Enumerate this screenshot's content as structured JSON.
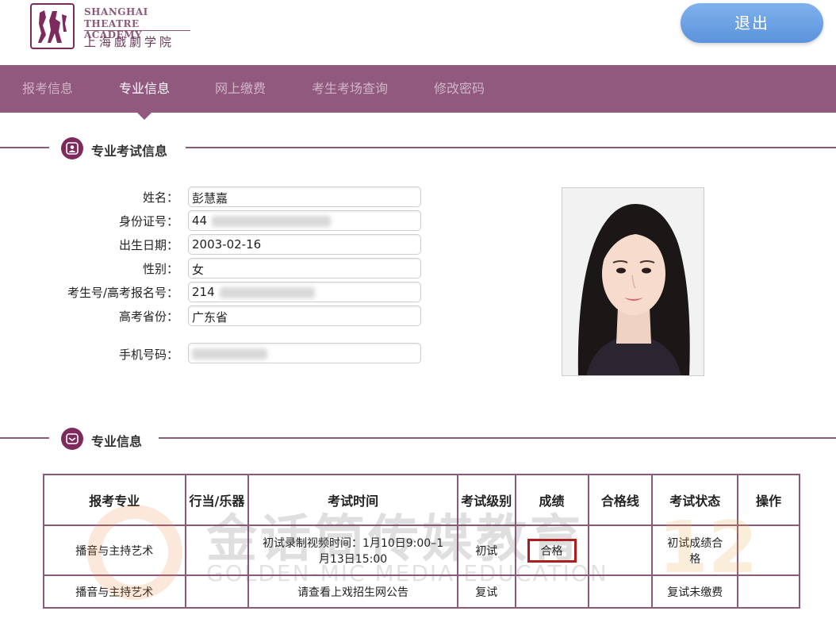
{
  "header": {
    "logo_en_line1": "SHANGHAI",
    "logo_en_line2": "THEATRE ACADEMY",
    "logo_cn": "上海戲劇学院",
    "logout_label": "退出"
  },
  "nav": {
    "items": [
      {
        "label": "报考信息"
      },
      {
        "label": "专业信息"
      },
      {
        "label": "网上缴费"
      },
      {
        "label": "考生考场查询"
      },
      {
        "label": "修改密码"
      }
    ],
    "active_index": 1
  },
  "exam_info": {
    "title": "专业考试信息",
    "fields": [
      {
        "label": "姓名：",
        "value": "彭慧嘉"
      },
      {
        "label": "身份证号：",
        "value": "44"
      },
      {
        "label": "出生日期：",
        "value": "2003-02-16"
      },
      {
        "label": "性别：",
        "value": "女"
      },
      {
        "label": "考生号/高考报名号：",
        "value": "214"
      },
      {
        "label": "高考省份：",
        "value": "广东省"
      },
      {
        "label": "手机号码：",
        "value": ""
      }
    ]
  },
  "major_info": {
    "title": "专业信息",
    "columns": [
      "报考专业",
      "行当/乐器",
      "考试时间",
      "考试级别",
      "成绩",
      "合格线",
      "考试状态",
      "操作"
    ],
    "rows": [
      {
        "major": "播音与主持艺术",
        "instrument": "",
        "time": "初试录制视频时间：1月10日9:00–1月13日15:00",
        "level": "初试",
        "score": "合格",
        "pass_line": "",
        "status": "初试成绩合格",
        "action": ""
      },
      {
        "major": "播音与主持艺术",
        "instrument": "",
        "time": "请查看上戏招生网公告",
        "level": "复试",
        "score": "",
        "pass_line": "",
        "status": "复试未缴费",
        "action": ""
      }
    ]
  },
  "watermark": {
    "text_cn": "金话筒传媒教育",
    "text_en": "GOLDEN-MIC MEDIA EDUCATION",
    "badge": "12"
  },
  "colors": {
    "brand_purple": "#92597f",
    "logout_blue": "#5b93db",
    "highlight_red": "#b01c1c"
  }
}
